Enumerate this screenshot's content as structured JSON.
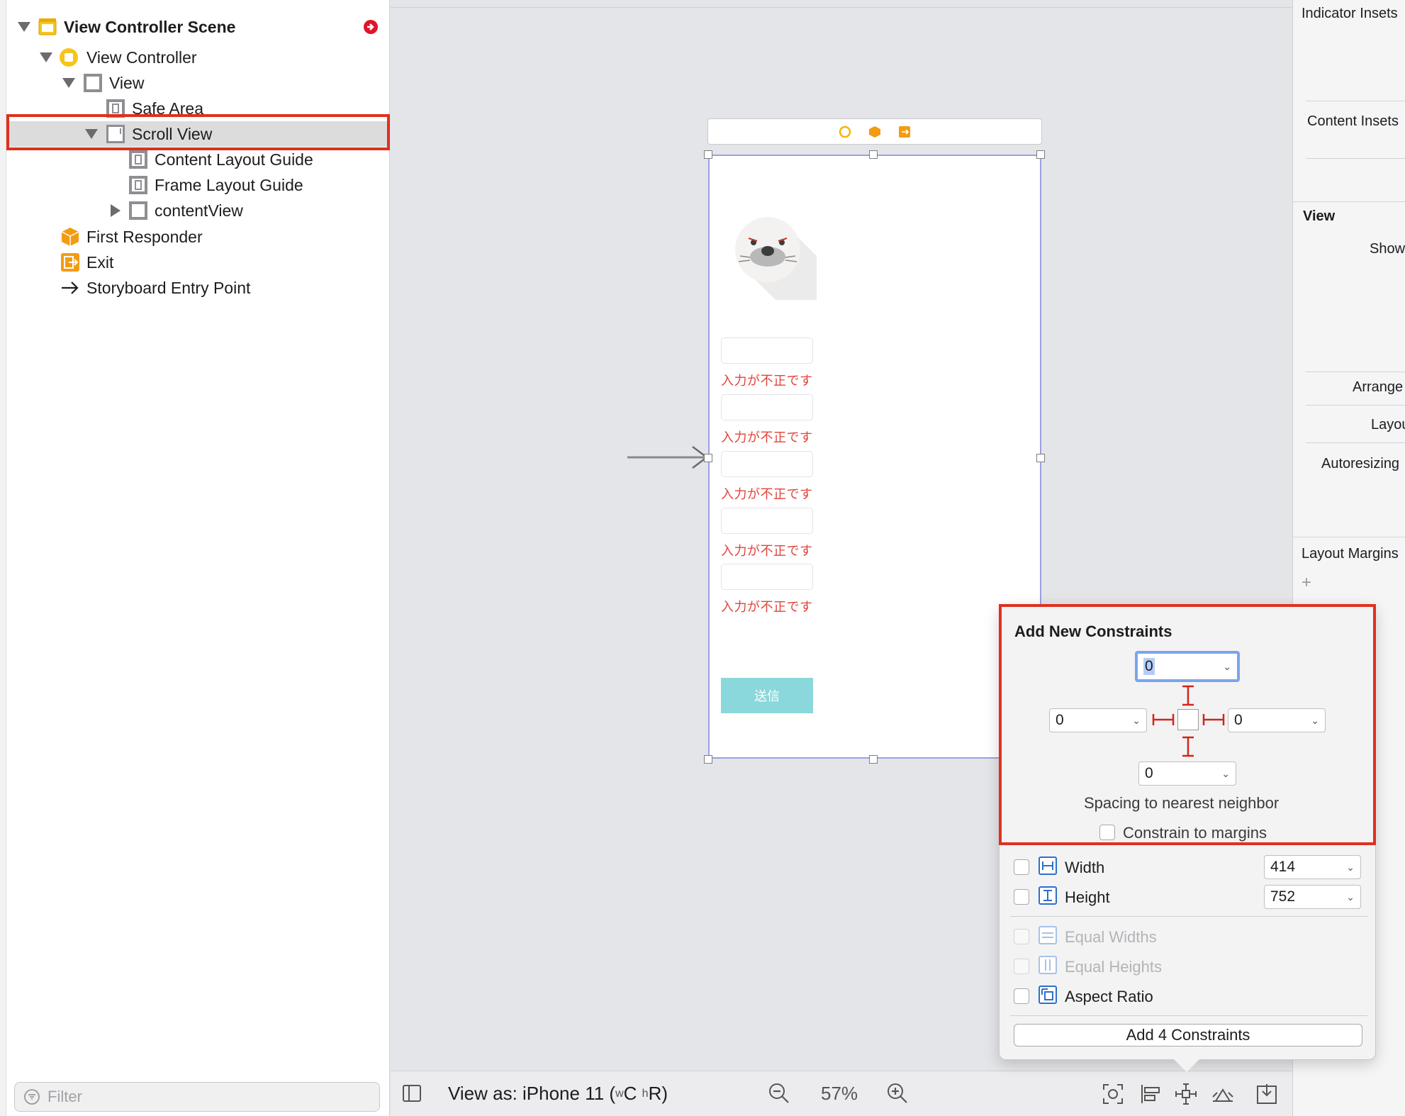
{
  "outline": {
    "items": [
      {
        "label": "View Controller Scene"
      },
      {
        "label": "View Controller"
      },
      {
        "label": "View"
      },
      {
        "label": "Safe Area"
      },
      {
        "label": "Scroll View"
      },
      {
        "label": "Content Layout Guide"
      },
      {
        "label": "Frame Layout Guide"
      },
      {
        "label": "contentView"
      },
      {
        "label": "First Responder"
      },
      {
        "label": "Exit"
      },
      {
        "label": "Storyboard Entry Point"
      }
    ],
    "filter_placeholder": "Filter"
  },
  "canvas": {
    "error_text": "入力が不正です",
    "submit_label": "送信",
    "error_count": 5
  },
  "inspector": {
    "indicator_insets": "Indicator Insets",
    "content_insets": "Content Insets",
    "view_section": "View",
    "show": "Show",
    "arrange": "Arrange",
    "layout": "Layout",
    "autoresizing": "Autoresizing",
    "layout_margins": "Layout Margins"
  },
  "bottombar": {
    "view_as_prefix": "View as: iPhone 11 (",
    "size_w": "w",
    "size_c": "C",
    "size_h": "h",
    "size_r": "R",
    "view_as_suffix": ")",
    "zoom": "57%"
  },
  "constraints": {
    "title": "Add New Constraints",
    "top": "0",
    "left": "0",
    "right": "0",
    "bottom": "0",
    "spacing_label": "Spacing to nearest neighbor",
    "constrain_margins": "Constrain to margins",
    "width_label": "Width",
    "width_value": "414",
    "height_label": "Height",
    "height_value": "752",
    "equal_widths": "Equal Widths",
    "equal_heights": "Equal Heights",
    "aspect_ratio": "Aspect Ratio",
    "add_button": "Add 4 Constraints"
  },
  "colors": {
    "highlight": "#e0301e",
    "error": "#e0443a",
    "submit_bg": "#8ad8dc",
    "selection_border": "#9aa2e0",
    "constraint_red": "#d0261c",
    "focus": "#7aa4ee"
  }
}
